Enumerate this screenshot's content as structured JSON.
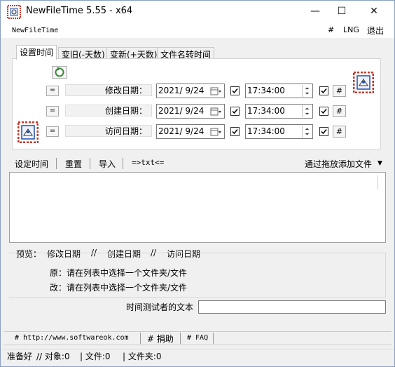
{
  "window": {
    "title": "NewFileTime 5.55 - x64",
    "minimize": "—",
    "maximize": "☐",
    "close": "✕"
  },
  "menu": {
    "app_name": "NewFileTime",
    "hash": "#",
    "lng": "LNG",
    "exit": "退出"
  },
  "tabs": [
    {
      "label": "设置时间"
    },
    {
      "label": "变旧(-天数)"
    },
    {
      "label": "变新(+天数)"
    },
    {
      "label": "文件名转时间"
    }
  ],
  "rows": [
    {
      "eq": "=",
      "label": "修改日期：",
      "date": "2021/ 9/24",
      "checked": true,
      "time": "17:34:00",
      "hash": "#"
    },
    {
      "eq": "=",
      "label": "创建日期：",
      "date": "2021/ 9/24",
      "checked": true,
      "time": "17:34:00",
      "hash": "#"
    },
    {
      "eq": "=",
      "label": "访问日期：",
      "date": "2021/ 9/24",
      "checked": true,
      "time": "17:34:00",
      "hash": "#"
    }
  ],
  "toolbar": {
    "set_time": "设定时间",
    "reset": "重置",
    "import": "导入",
    "txt": "=>txt<=",
    "drag_add": "通过拖放添加文件",
    "drag_arrow": "▼"
  },
  "preview": {
    "label": "预览：",
    "modified": "修改日期",
    "sep1": "//",
    "created": "创建日期",
    "sep2": "//",
    "accessed": "访问日期",
    "orig_label": "原：",
    "orig_text": "请在列表中选择一个文件夹/文件",
    "new_label": "改：",
    "new_text": "请在列表中选择一个文件夹/文件"
  },
  "time_tester": {
    "label": "时间测试者的文本",
    "value": ""
  },
  "footer": {
    "website": "# http://www.softwareok.com",
    "donate": "# 捐助",
    "faq": "# FAQ"
  },
  "status": {
    "ready": "准备好",
    "objects": "// 对象:0",
    "files": "| 文件:0",
    "folders": "| 文件夹:0"
  },
  "colors": {
    "accent": "#0078d7",
    "icon_red": "#c0392b",
    "icon_blue": "#1f4fa8"
  }
}
